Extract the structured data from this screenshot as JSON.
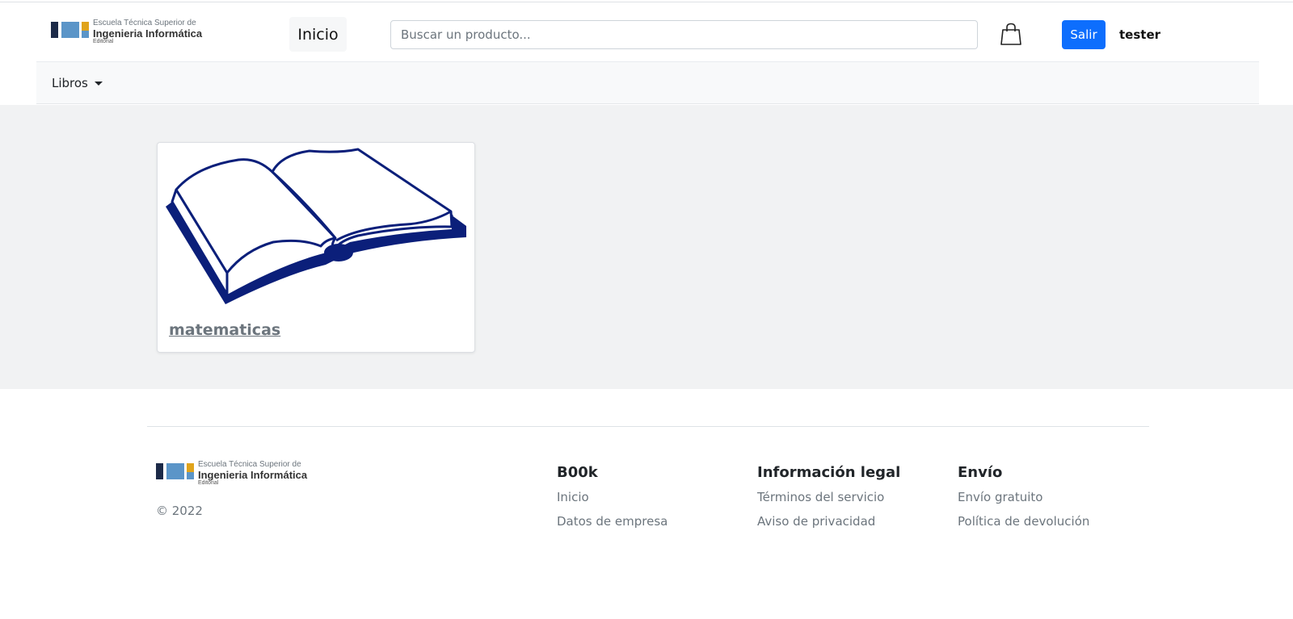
{
  "logo": {
    "line1": "Escuela Técnica Superior de",
    "line2": "Ingenieria Informática",
    "line3": "Editorial"
  },
  "header": {
    "home_label": "Inicio",
    "search_placeholder": "Buscar un producto...",
    "cart_icon": "shopping-bag-icon",
    "logout_label": "Salir",
    "username": "tester"
  },
  "nav": {
    "dropdown_label": "Libros"
  },
  "products": [
    {
      "name": "matematicas",
      "image_icon": "open-book-icon"
    }
  ],
  "footer": {
    "copyright": "© 2022",
    "columns": [
      {
        "title": "B00k",
        "links": [
          "Inicio",
          "Datos de empresa"
        ]
      },
      {
        "title": "Información legal",
        "links": [
          "Términos del servicio",
          "Aviso de privacidad"
        ]
      },
      {
        "title": "Envío",
        "links": [
          "Envío gratuito",
          "Política de devolución"
        ]
      }
    ]
  },
  "colors": {
    "primary_button": "#0d6efd",
    "book_illustration": "#0b1f7a",
    "logo_dark": "#1c2a48",
    "logo_blue": "#5b95c8",
    "logo_yellow": "#e0a41c"
  }
}
